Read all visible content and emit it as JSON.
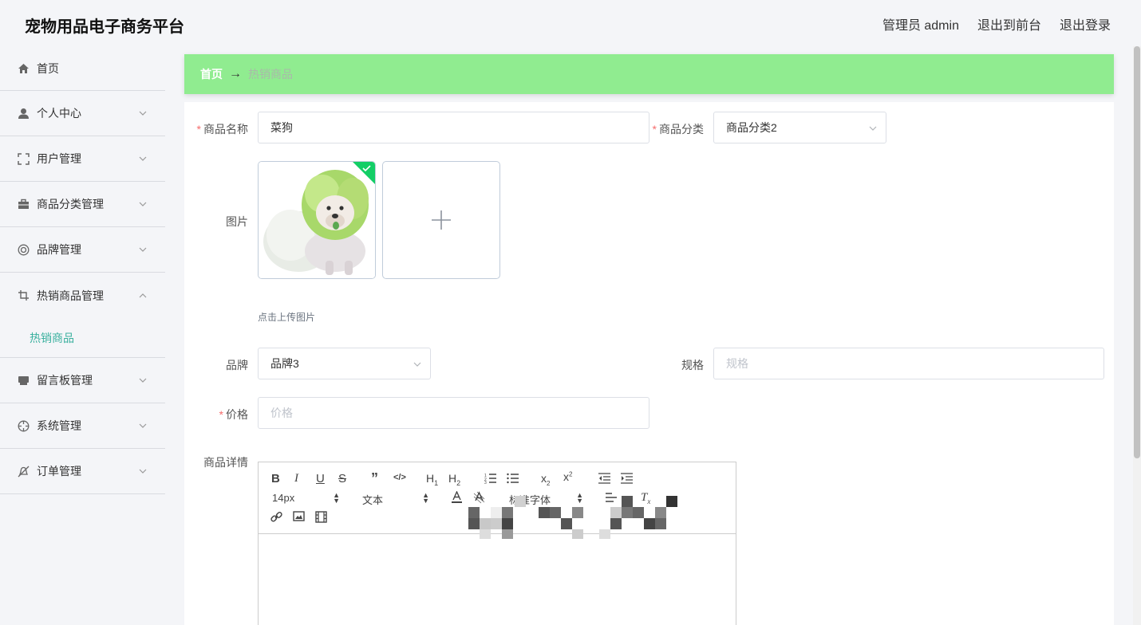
{
  "header": {
    "brand": "宠物用品电子商务平台",
    "links": [
      "管理员 admin",
      "退出到前台",
      "退出登录"
    ]
  },
  "sidebar": {
    "items": [
      {
        "label": "首页",
        "icon": "home-icon"
      },
      {
        "label": "个人中心",
        "icon": "user-icon"
      },
      {
        "label": "用户管理",
        "icon": "scan-frame-icon"
      },
      {
        "label": "商品分类管理",
        "icon": "briefcase-icon"
      },
      {
        "label": "品牌管理",
        "icon": "lifebuoy-icon"
      },
      {
        "label": "热销商品管理",
        "icon": "crop-icon"
      },
      {
        "label": "留言板管理",
        "icon": "printer-icon"
      },
      {
        "label": "系统管理",
        "icon": "target-icon"
      },
      {
        "label": "订单管理",
        "icon": "bell-off-icon"
      }
    ],
    "subitem": "热销商品"
  },
  "breadcrumb": {
    "home": "首页",
    "arrow": "→",
    "current": "热销商品"
  },
  "form": {
    "name_label": "商品名称",
    "name_value": "菜狗",
    "category_label": "商品分类",
    "category_value": "商品分类2",
    "picture_label": "图片",
    "upload_hint": "点击上传图片",
    "brand_label": "品牌",
    "brand_value": "品牌3",
    "spec_label": "规格",
    "spec_placeholder": "规格",
    "price_label": "价格",
    "price_placeholder": "价格",
    "detail_label": "商品详情"
  },
  "editor": {
    "font_size": "14px",
    "header_select": "文本",
    "font_family": "标准字体"
  },
  "colors": {
    "accent": "#3ab09e",
    "breadcrumb_bg": "#90ec90",
    "required": "#f56c6c"
  }
}
